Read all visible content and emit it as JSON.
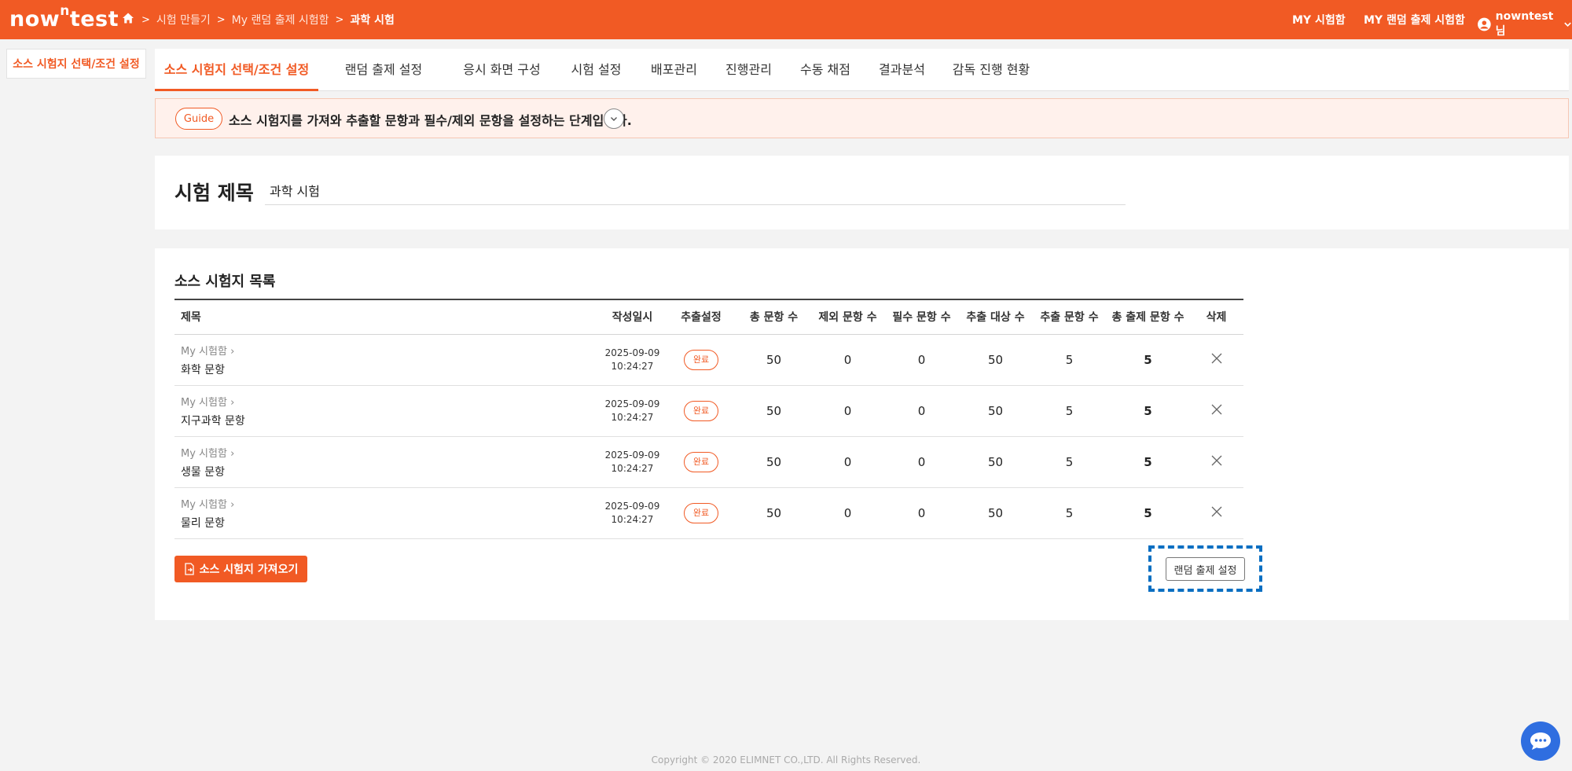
{
  "header": {
    "logo_main": "now",
    "logo_sup": "n",
    "logo_tail": "test",
    "breadcrumb": [
      "시험 만들기",
      "My 랜덤 출제 시험함",
      "과학 시험"
    ],
    "nav": [
      "MY 시험함",
      "MY 랜덤 출제 시험함"
    ],
    "user": "nowntest님"
  },
  "sidebar": {
    "active_label": "소스 시험지 선택/조건 설정"
  },
  "tabs": [
    "소스 시험지 선택/조건 설정",
    "랜덤 출제 설정",
    "응시 화면 구성",
    "시험 설정",
    "배포관리",
    "진행관리",
    "수동 채점",
    "결과분석",
    "감독 진행 현황"
  ],
  "guide": {
    "badge": "Guide",
    "text": "소스 시험지를 가져와 추출할 문항과 필수/제외 문항을 설정하는 단계입니다."
  },
  "exam": {
    "label": "시험 제목",
    "value": "과학 시험"
  },
  "list": {
    "title": "소스 시험지 목록",
    "columns": [
      "제목",
      "작성일시",
      "추출설정",
      "총 문항 수",
      "제외 문항 수",
      "필수 문항 수",
      "추출 대상 수",
      "추출 문항 수",
      "총 출제 문항 수",
      "삭제"
    ],
    "rows": [
      {
        "source": "My 시험함",
        "name": "화학 문항",
        "date": "2025-09-09",
        "time": "10:24:27",
        "status": "완료",
        "total": "50",
        "excluded": "0",
        "required": "0",
        "target": "50",
        "extract": "5",
        "final": "5"
      },
      {
        "source": "My 시험함",
        "name": "지구과학 문항",
        "date": "2025-09-09",
        "time": "10:24:27",
        "status": "완료",
        "total": "50",
        "excluded": "0",
        "required": "0",
        "target": "50",
        "extract": "5",
        "final": "5"
      },
      {
        "source": "My 시험함",
        "name": "생물 문항",
        "date": "2025-09-09",
        "time": "10:24:27",
        "status": "완료",
        "total": "50",
        "excluded": "0",
        "required": "0",
        "target": "50",
        "extract": "5",
        "final": "5"
      },
      {
        "source": "My 시험함",
        "name": "물리 문항",
        "date": "2025-09-09",
        "time": "10:24:27",
        "status": "완료",
        "total": "50",
        "excluded": "0",
        "required": "0",
        "target": "50",
        "extract": "5",
        "final": "5"
      }
    ],
    "import_button": "소스 시험지 가져오기",
    "next_button": "랜덤 출제 설정"
  },
  "footer": "Copyright © 2020 ELIMNET CO.,LTD. All Rights Reserved.",
  "colors": {
    "brand": "#f15a24",
    "highlight": "#0a6fc2",
    "chat": "#2f6ee0"
  }
}
